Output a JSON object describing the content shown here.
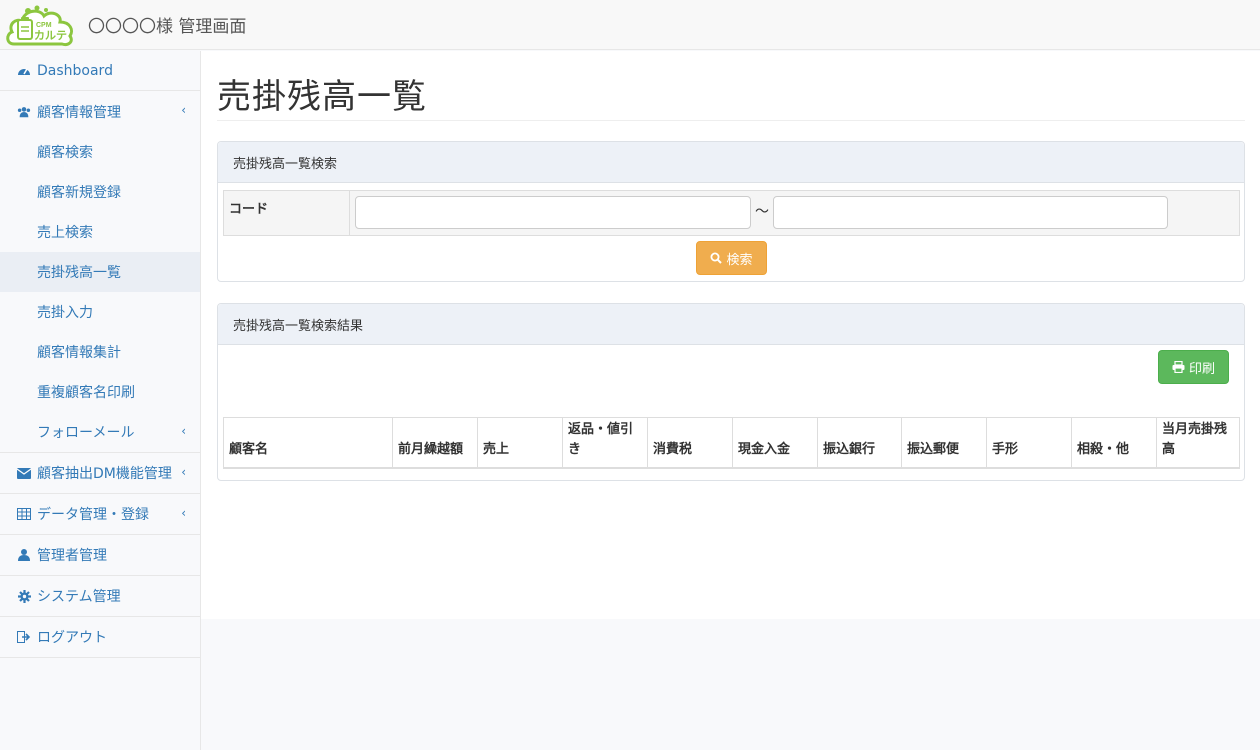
{
  "header": {
    "logo_text_top": "CPM",
    "logo_text_bottom": "カルテ",
    "title": "〇〇〇〇様 管理画面"
  },
  "sidebar": {
    "items": [
      {
        "label": "Dashboard",
        "icon": "dashboard-icon"
      },
      {
        "label": "顧客情報管理",
        "icon": "users-icon"
      },
      {
        "label": "顧客抽出DM機能管理",
        "icon": "envelope-icon"
      },
      {
        "label": "データ管理・登録",
        "icon": "table-icon"
      },
      {
        "label": "管理者管理",
        "icon": "user-icon"
      },
      {
        "label": "システム管理",
        "icon": "gear-icon"
      },
      {
        "label": "ログアウト",
        "icon": "logout-icon"
      }
    ],
    "sub_items": [
      {
        "label": "顧客検索"
      },
      {
        "label": "顧客新規登録"
      },
      {
        "label": "売上検索"
      },
      {
        "label": "売掛残高一覧"
      },
      {
        "label": "売掛入力"
      },
      {
        "label": "顧客情報集計"
      },
      {
        "label": "重複顧客名印刷"
      },
      {
        "label": "フォローメール"
      }
    ]
  },
  "main": {
    "page_title": "売掛残高一覧",
    "search_panel": {
      "heading": "売掛残高一覧検索",
      "code_label": "コード",
      "range_separator": "～",
      "code_from_value": "",
      "code_to_value": "",
      "search_button": "検索"
    },
    "result_panel": {
      "heading": "売掛残高一覧検索結果",
      "print_button": "印刷",
      "columns": [
        "顧客名",
        "前月繰越額",
        "売上",
        "返品・値引き",
        "消費税",
        "現金入金",
        "振込銀行",
        "振込郵便",
        "手形",
        "相殺・他",
        "当月売掛残高"
      ]
    }
  },
  "colors": {
    "link": "#337ab7",
    "warning_button": "#f0ad4e",
    "success_button": "#5cb85c",
    "panel_heading": "#edf1f7",
    "logo_green": "#8cc63f"
  }
}
